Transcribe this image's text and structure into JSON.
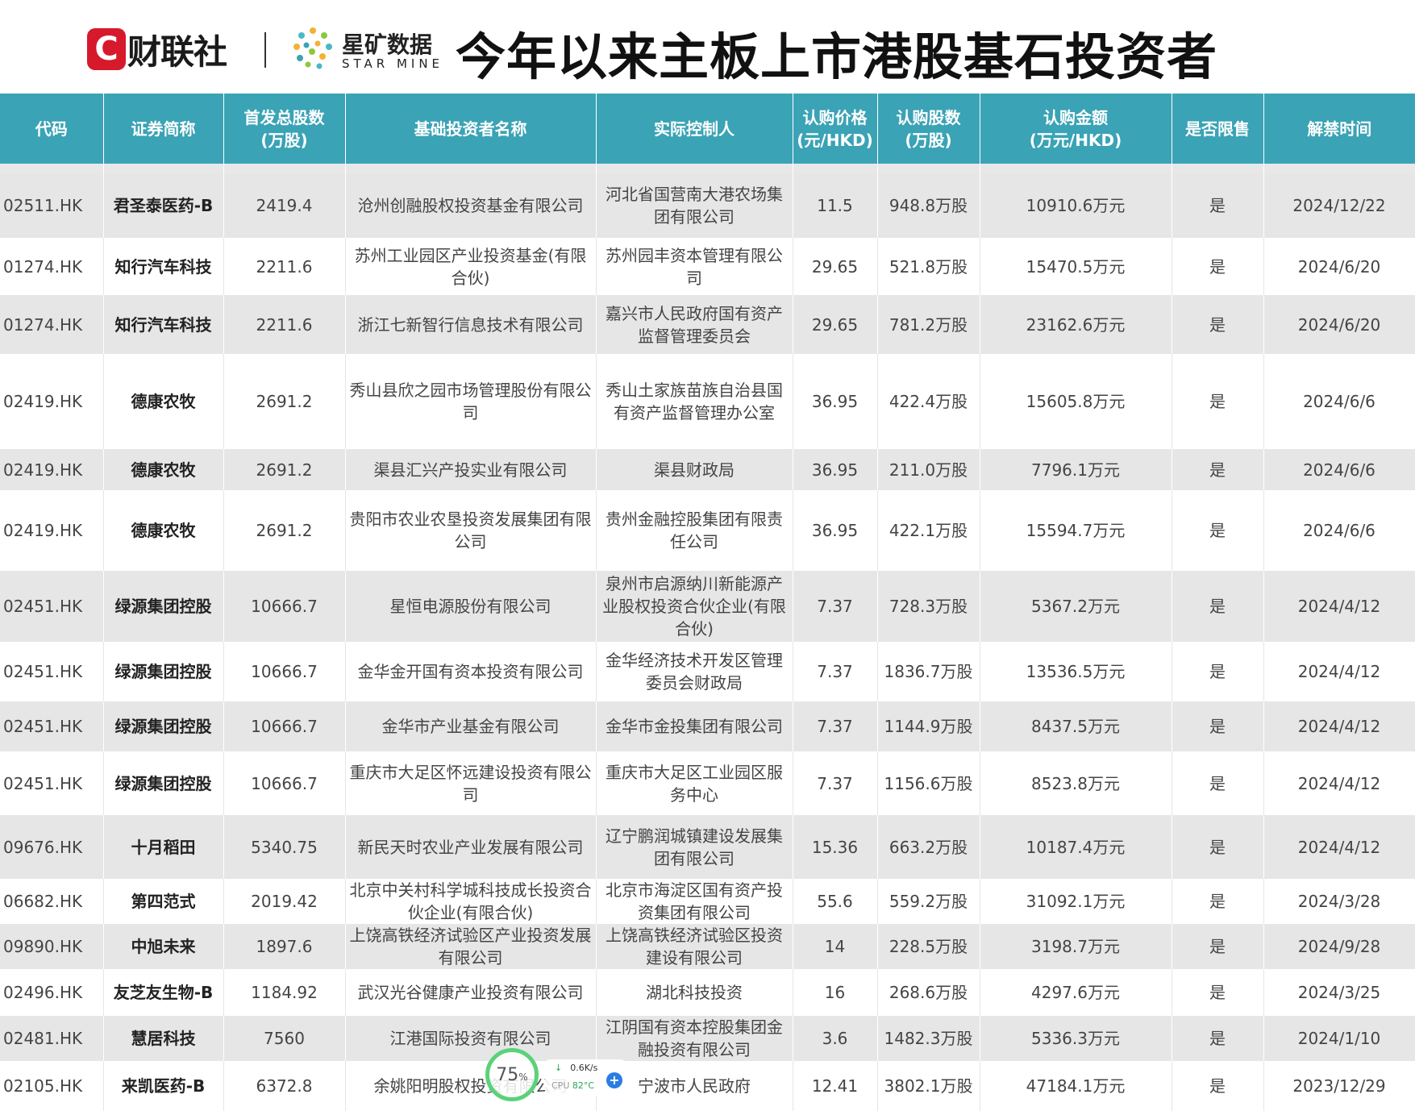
{
  "header": {
    "brand_cls_mark": "C",
    "brand_cls": "财联社",
    "brand_star_cn": "星矿数据",
    "brand_star_en": "STAR MINE",
    "title": "今年以来主板上市港股基石投资者"
  },
  "columns": [
    "代码",
    "证券简称",
    "首发总股数\n(万股)",
    "基础投资者名称",
    "实际控制人",
    "认购价格\n(元/HKD)",
    "认购股数\n(万股)",
    "认购金额\n(万元/HKD)",
    "是否限售",
    "解禁时间"
  ],
  "rows": [
    [
      "02511.HK",
      "君圣泰医药-B",
      "2419.4",
      "沧州创融股权投资基金有限公司",
      "河北省国营南大港农场集团有限公司",
      "11.5",
      "948.8万股",
      "10910.6万元",
      "是",
      "2024/12/22"
    ],
    [
      "01274.HK",
      "知行汽车科技",
      "2211.6",
      "苏州工业园区产业投资基金(有限合伙)",
      "苏州园丰资本管理有限公司",
      "29.65",
      "521.8万股",
      "15470.5万元",
      "是",
      "2024/6/20"
    ],
    [
      "01274.HK",
      "知行汽车科技",
      "2211.6",
      "浙江七新智行信息技术有限公司",
      "嘉兴市人民政府国有资产监督管理委员会",
      "29.65",
      "781.2万股",
      "23162.6万元",
      "是",
      "2024/6/20"
    ],
    [
      "02419.HK",
      "德康农牧",
      "2691.2",
      "秀山县欣之园市场管理股份有限公司",
      "秀山土家族苗族自治县国有资产监督管理办公室",
      "36.95",
      "422.4万股",
      "15605.8万元",
      "是",
      "2024/6/6"
    ],
    [
      "02419.HK",
      "德康农牧",
      "2691.2",
      "渠县汇兴产投实业有限公司",
      "渠县财政局",
      "36.95",
      "211.0万股",
      "7796.1万元",
      "是",
      "2024/6/6"
    ],
    [
      "02419.HK",
      "德康农牧",
      "2691.2",
      "贵阳市农业农垦投资发展集团有限公司",
      "贵州金融控股集团有限责任公司",
      "36.95",
      "422.1万股",
      "15594.7万元",
      "是",
      "2024/6/6"
    ],
    [
      "02451.HK",
      "绿源集团控股",
      "10666.7",
      "星恒电源股份有限公司",
      "泉州市启源纳川新能源产业股权投资合伙企业(有限合伙)",
      "7.37",
      "728.3万股",
      "5367.2万元",
      "是",
      "2024/4/12"
    ],
    [
      "02451.HK",
      "绿源集团控股",
      "10666.7",
      "金华金开国有资本投资有限公司",
      "金华经济技术开发区管理委员会财政局",
      "7.37",
      "1836.7万股",
      "13536.5万元",
      "是",
      "2024/4/12"
    ],
    [
      "02451.HK",
      "绿源集团控股",
      "10666.7",
      "金华市产业基金有限公司",
      "金华市金投集团有限公司",
      "7.37",
      "1144.9万股",
      "8437.5万元",
      "是",
      "2024/4/12"
    ],
    [
      "02451.HK",
      "绿源集团控股",
      "10666.7",
      "重庆市大足区怀远建设投资有限公司",
      "重庆市大足区工业园区服务中心",
      "7.37",
      "1156.6万股",
      "8523.8万元",
      "是",
      "2024/4/12"
    ],
    [
      "09676.HK",
      "十月稻田",
      "5340.75",
      "新民天时农业产业发展有限公司",
      "辽宁鹏润城镇建设发展集团有限公司",
      "15.36",
      "663.2万股",
      "10187.4万元",
      "是",
      "2024/4/12"
    ],
    [
      "06682.HK",
      "第四范式",
      "2019.42",
      "北京中关村科学城科技成长投资合伙企业(有限合伙)",
      "北京市海淀区国有资产投资集团有限公司",
      "55.6",
      "559.2万股",
      "31092.1万元",
      "是",
      "2024/3/28"
    ],
    [
      "09890.HK",
      "中旭未来",
      "1897.6",
      "上饶高铁经济试验区产业投资发展有限公司",
      "上饶高铁经济试验区投资建设有限公司",
      "14",
      "228.5万股",
      "3198.7万元",
      "是",
      "2024/9/28"
    ],
    [
      "02496.HK",
      "友芝友生物-B",
      "1184.92",
      "武汉光谷健康产业投资有限公司",
      "湖北科技投资",
      "16",
      "268.6万股",
      "4297.6万元",
      "是",
      "2024/3/25"
    ],
    [
      "02481.HK",
      "慧居科技",
      "7560",
      "江港国际投资有限公司",
      "江阴国有资本控股集团金融投资有限公司",
      "3.6",
      "1482.3万股",
      "5336.3万元",
      "是",
      "2024/1/10"
    ],
    [
      "02105.HK",
      "来凯医药-B",
      "6372.8",
      "余姚阳明股权投资有限公司",
      "宁波市人民政府",
      "12.41",
      "3802.1万股",
      "47184.1万元",
      "是",
      "2023/12/29"
    ]
  ],
  "widget": {
    "cpu_percent": "75",
    "percent_sign": "%",
    "net_speed": "0.6K/s",
    "cpu_label": "CPU",
    "cpu_temp": "82°C",
    "plus": "+"
  }
}
